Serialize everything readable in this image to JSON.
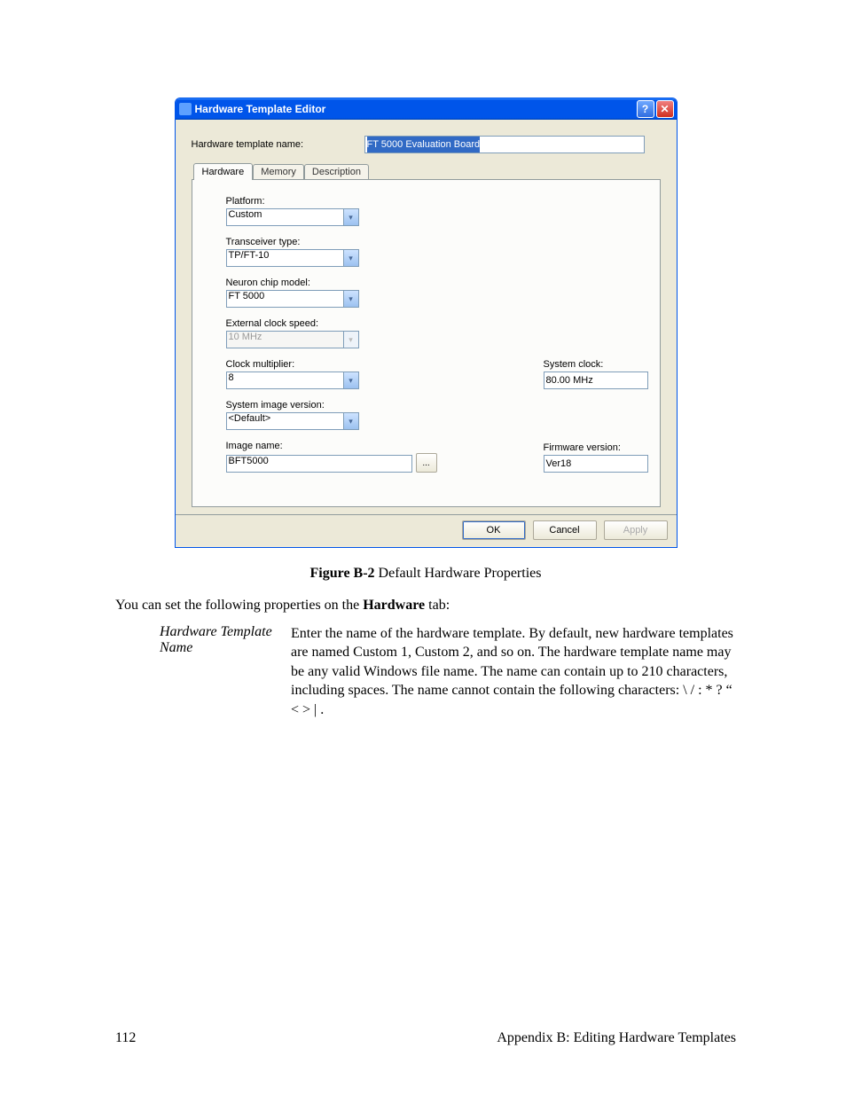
{
  "dialog": {
    "title": "Hardware Template Editor",
    "name_label": "Hardware template name:",
    "name_value": "FT 5000 Evaluation Board",
    "tabs": [
      "Hardware",
      "Memory",
      "Description"
    ],
    "active_tab": 0,
    "fields": {
      "platform_label": "Platform:",
      "platform_value": "Custom",
      "transceiver_label": "Transceiver type:",
      "transceiver_value": "TP/FT-10",
      "neuron_label": "Neuron chip model:",
      "neuron_value": "FT 5000",
      "extclock_label": "External clock speed:",
      "extclock_value": "10 MHz",
      "multiplier_label": "Clock multiplier:",
      "multiplier_value": "8",
      "sysclock_label": "System clock:",
      "sysclock_value": "80.00 MHz",
      "sysimg_label": "System image version:",
      "sysimg_value": "<Default>",
      "imgname_label": "Image name:",
      "imgname_value": "BFT5000",
      "browse_label": "...",
      "fwver_label": "Firmware version:",
      "fwver_value": "Ver18"
    },
    "buttons": {
      "ok": "OK",
      "cancel": "Cancel",
      "apply": "Apply"
    }
  },
  "caption_prefix": "Figure B-2",
  "caption_text": " Default Hardware Properties",
  "intro_text_a": "You can set the following properties on the ",
  "intro_text_b": "Hardware",
  "intro_text_c": " tab:",
  "def_term": "Hardware Template Name",
  "def_desc": "Enter the name of the hardware template.  By default, new hardware templates are named Custom 1, Custom 2, and so on.  The hardware template name may be any valid Windows file name.  The name can contain up to 210 characters, including spaces.  The name cannot contain the following characters: \\ / : * ? “ < > | .",
  "page_number": "112",
  "appendix_label": "Appendix B: Editing Hardware Templates"
}
